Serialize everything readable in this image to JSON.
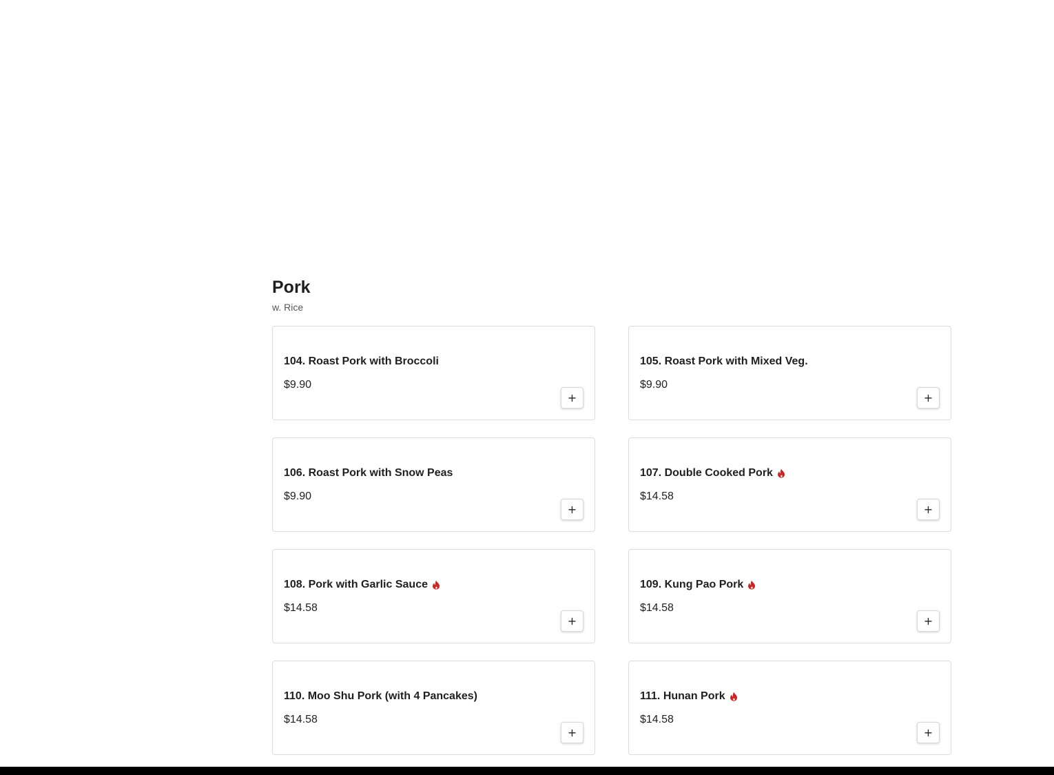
{
  "section": {
    "title": "Pork",
    "subtitle": "w. Rice"
  },
  "items": [
    {
      "name": "104. Roast Pork with Broccoli",
      "price": "$9.90",
      "spicy": false,
      "add_label": "+"
    },
    {
      "name": "105. Roast Pork with Mixed Veg.",
      "price": "$9.90",
      "spicy": false,
      "add_label": "+"
    },
    {
      "name": "106. Roast Pork with Snow Peas",
      "price": "$9.90",
      "spicy": false,
      "add_label": "+"
    },
    {
      "name": "107. Double Cooked Pork",
      "price": "$14.58",
      "spicy": true,
      "add_label": "+"
    },
    {
      "name": "108. Pork with Garlic Sauce",
      "price": "$14.58",
      "spicy": true,
      "add_label": "+"
    },
    {
      "name": "109. Kung Pao Pork",
      "price": "$14.58",
      "spicy": true,
      "add_label": "+"
    },
    {
      "name": "110. Moo Shu Pork (with 4 Pancakes)",
      "price": "$14.58",
      "spicy": false,
      "add_label": "+"
    },
    {
      "name": "111. Hunan Pork",
      "price": "$14.58",
      "spicy": true,
      "add_label": "+"
    }
  ],
  "icons": {
    "spicy": "flame-icon",
    "spicy_color": "#c62828",
    "add": "plus-icon"
  }
}
